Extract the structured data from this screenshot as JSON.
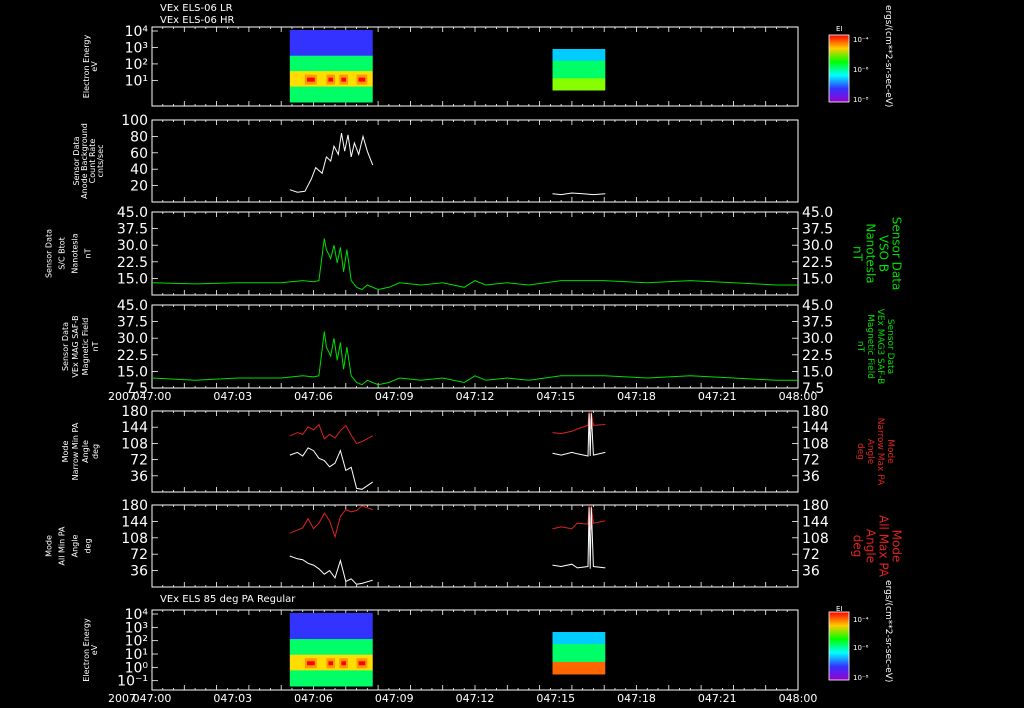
{
  "title_lines": [
    "VEx ELS-06 LR",
    "VEx ELS-06 HR"
  ],
  "title_bottom": "VEx ELS 85 deg PA Regular",
  "x_axis": {
    "year": "2007",
    "ticks": [
      "047:00",
      "047:03",
      "047:06",
      "047:09",
      "047:12",
      "047:15",
      "047:18",
      "047:21",
      "048:00"
    ],
    "range_minutes": [
      0,
      60
    ]
  },
  "colors": {
    "background": "#000000",
    "axis": "#ffffff",
    "bfield": "#00dd00",
    "red": "#dd2222",
    "white": "#ffffff"
  },
  "colorbars": [
    {
      "label": "EI",
      "ticks": [
        "10⁻⁴",
        "10⁻⁶",
        "10⁻⁸"
      ],
      "unit": "ergs/(cm**2-sr-sec-eV)"
    },
    {
      "label": "EI",
      "ticks": [
        "10⁻⁴",
        "10⁻⁶",
        "10⁻⁸"
      ],
      "unit": "ergs/(cm**2-sr-sec-eV)"
    }
  ],
  "chart_data": [
    {
      "type": "heatmap",
      "ylabel": [
        "Electron Energy",
        "eV"
      ],
      "yticks": [
        "10⁴",
        "10³",
        "10²",
        "10¹"
      ],
      "log_scale": true,
      "blocks_minutes": [
        [
          12.8,
          20.5
        ],
        [
          37.2,
          42.1
        ]
      ]
    },
    {
      "type": "line",
      "ylabel": [
        "Sensor Data",
        "Anode Background",
        "Count Rate",
        "cnts/sec"
      ],
      "yticks": [
        "100",
        "80",
        "60",
        "40",
        "20"
      ],
      "ylim": [
        0,
        100
      ],
      "series": [
        {
          "color": "white",
          "x": [
            12.8,
            13.5,
            14.2,
            14.8,
            15.2,
            15.8,
            16.2,
            16.6,
            16.9,
            17.3,
            17.6,
            17.9,
            18.2,
            18.5,
            18.8,
            19.2,
            19.6,
            20.0,
            20.5
          ],
          "y": [
            15,
            12,
            13,
            28,
            42,
            35,
            55,
            50,
            68,
            58,
            84,
            62,
            82,
            55,
            72,
            58,
            80,
            62,
            45
          ]
        },
        {
          "color": "white",
          "x": [
            37.2,
            38,
            39,
            40,
            41,
            42.1
          ],
          "y": [
            10,
            9,
            11,
            10,
            9,
            10
          ]
        }
      ]
    },
    {
      "type": "line",
      "ylabel": [
        "Sensor Data",
        "S/C Btot",
        "Nanotesla",
        "nT"
      ],
      "right_label": [
        "Sensor Data",
        "VSO B",
        "Nanotesla",
        "nT"
      ],
      "yticks": [
        "45.0",
        "37.5",
        "30.0",
        "22.5",
        "15.0"
      ],
      "ylim": [
        7.5,
        45
      ],
      "series": [
        {
          "color": "bfield",
          "x": [
            0,
            4,
            8,
            12,
            14,
            15,
            15.5,
            16,
            16.2,
            16.6,
            16.9,
            17.2,
            17.5,
            17.8,
            18.1,
            18.5,
            19,
            19.5,
            20,
            21,
            22,
            23,
            25,
            27,
            29,
            30,
            31,
            33,
            35,
            38,
            42,
            46,
            50,
            54,
            58,
            60
          ],
          "y": [
            13,
            12.5,
            13,
            13,
            14,
            13.5,
            14,
            33,
            28,
            24,
            30,
            22,
            29,
            18,
            28,
            14,
            11,
            10,
            12,
            10,
            11,
            13,
            12,
            13,
            11,
            14,
            12,
            13,
            12,
            14,
            14,
            13,
            14,
            13,
            12,
            12
          ]
        }
      ]
    },
    {
      "type": "line",
      "ylabel": [
        "Sensor Data",
        "VEx MAG SAF-B",
        "Magnetic Field",
        "nT"
      ],
      "right_label": [
        "Sensor Data",
        "VEx MAG3 SAF-B",
        "Magnetic Field",
        "nT"
      ],
      "yticks": [
        "45.0",
        "37.5",
        "30.0",
        "22.5",
        "15.0",
        "7.5"
      ],
      "ylim": [
        7.5,
        45
      ],
      "series": [
        {
          "color": "bfield",
          "x": [
            0,
            4,
            8,
            12,
            14,
            15,
            15.5,
            16,
            16.2,
            16.6,
            16.9,
            17.2,
            17.5,
            17.8,
            18.1,
            18.5,
            19,
            19.5,
            20,
            21,
            22,
            23,
            25,
            27,
            29,
            30,
            31,
            33,
            35,
            38,
            42,
            46,
            50,
            54,
            58,
            60
          ],
          "y": [
            12,
            11,
            12,
            12,
            13,
            12.5,
            13,
            33,
            26,
            22,
            30,
            20,
            28,
            16,
            26,
            13,
            10,
            9,
            11,
            9,
            10,
            12,
            11,
            12,
            10,
            13,
            11,
            12,
            11,
            13,
            13,
            12,
            13,
            12,
            11,
            11
          ]
        }
      ]
    },
    {
      "type": "line",
      "ylabel": [
        "Mode",
        "Narrow Min PA",
        "Angle",
        "deg"
      ],
      "right_label": [
        "Mode",
        "Narrow Max PA",
        "Angle",
        "deg"
      ],
      "yticks": [
        "180",
        "144",
        "108",
        "72",
        "36"
      ],
      "ylim": [
        0,
        180
      ],
      "series": [
        {
          "color": "red",
          "x": [
            12.8,
            13.5,
            14,
            14.5,
            15,
            15.5,
            16,
            16.5,
            17,
            17.5,
            18,
            18.5,
            19,
            19.5,
            20.5
          ],
          "y": [
            125,
            132,
            128,
            145,
            138,
            150,
            118,
            128,
            120,
            136,
            148,
            126,
            108,
            112,
            125
          ]
        },
        {
          "color": "white",
          "x": [
            12.8,
            13.5,
            14,
            14.5,
            15,
            15.5,
            16,
            16.5,
            17,
            17.5,
            18,
            18.5,
            19,
            19.5,
            20.5
          ],
          "y": [
            82,
            88,
            80,
            98,
            92,
            75,
            70,
            56,
            64,
            92,
            48,
            55,
            8,
            6,
            22
          ]
        },
        {
          "color": "red",
          "x": [
            37.2,
            38,
            39,
            39.5,
            40.5,
            40.6,
            40.7,
            40.8,
            41,
            42.1
          ],
          "y": [
            132,
            130,
            135,
            140,
            148,
            178,
            140,
            178,
            148,
            150
          ]
        },
        {
          "color": "white",
          "x": [
            37.2,
            38,
            39,
            39.5,
            40.5,
            40.6,
            40.7,
            40.8,
            41,
            42.1
          ],
          "y": [
            86,
            82,
            88,
            85,
            80,
            175,
            80,
            175,
            82,
            88
          ]
        }
      ]
    },
    {
      "type": "line",
      "ylabel": [
        "Mode",
        "All Min PA",
        "Angle",
        "deg"
      ],
      "right_label": [
        "Mode",
        "All Max PA",
        "Angle",
        "deg"
      ],
      "yticks": [
        "180",
        "144",
        "108",
        "72",
        "36"
      ],
      "ylim": [
        0,
        180
      ],
      "series": [
        {
          "color": "red",
          "x": [
            12.8,
            13.5,
            14,
            14.5,
            15,
            15.5,
            16,
            16.5,
            17,
            17.5,
            18,
            18.5,
            19,
            19.5,
            20.5
          ],
          "y": [
            118,
            125,
            130,
            150,
            128,
            140,
            162,
            145,
            110,
            155,
            170,
            165,
            168,
            178,
            170
          ]
        },
        {
          "color": "white",
          "x": [
            12.8,
            13.5,
            14,
            14.5,
            15,
            15.5,
            16,
            16.5,
            17,
            17.5,
            18,
            18.5,
            19,
            19.5,
            20.5
          ],
          "y": [
            68,
            62,
            60,
            52,
            48,
            40,
            28,
            36,
            20,
            58,
            12,
            18,
            6,
            8,
            15
          ]
        },
        {
          "color": "red",
          "x": [
            37.2,
            38,
            39,
            39.5,
            40.5,
            40.6,
            40.7,
            40.8,
            41,
            42.1
          ],
          "y": [
            128,
            132,
            128,
            140,
            138,
            178,
            125,
            178,
            140,
            145
          ]
        },
        {
          "color": "white",
          "x": [
            37.2,
            38,
            39,
            39.5,
            40.5,
            40.6,
            40.7,
            40.8,
            41,
            42.1
          ],
          "y": [
            48,
            45,
            50,
            42,
            45,
            175,
            40,
            175,
            45,
            42
          ]
        }
      ]
    },
    {
      "type": "heatmap",
      "ylabel": [
        "Electron Energy",
        "eV"
      ],
      "yticks": [
        "10⁴",
        "10³",
        "10²",
        "10¹",
        "10⁰",
        "10⁻¹"
      ],
      "log_scale": true,
      "blocks_minutes": [
        [
          12.8,
          20.5
        ],
        [
          37.2,
          42.1
        ]
      ]
    }
  ]
}
